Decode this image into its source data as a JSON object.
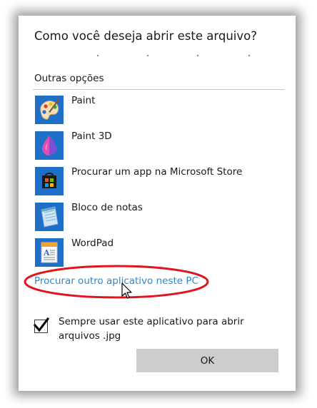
{
  "dialog": {
    "title": "Como você deseja abrir este arquivo?",
    "section_label": "Outras opções",
    "apps": [
      {
        "name": "Paint",
        "icon": "paint-palette-icon"
      },
      {
        "name": "Paint 3D",
        "icon": "paint-3d-icon"
      },
      {
        "name": "Procurar um app na Microsoft Store",
        "icon": "microsoft-store-icon"
      },
      {
        "name": "Bloco de notas",
        "icon": "notepad-icon"
      },
      {
        "name": "WordPad",
        "icon": "wordpad-icon"
      }
    ],
    "more_apps_link": "Procurar outro aplicativo neste PC",
    "always_use_checkbox": {
      "checked": true,
      "label": "Sempre usar este aplicativo para abrir arquivos .jpg"
    },
    "ok_label": "OK"
  },
  "colors": {
    "accent_link": "#2a8ad6",
    "icon_tile": "#1e6fc7",
    "highlight_ellipse": "#e0141e",
    "button": "#cccccc"
  }
}
